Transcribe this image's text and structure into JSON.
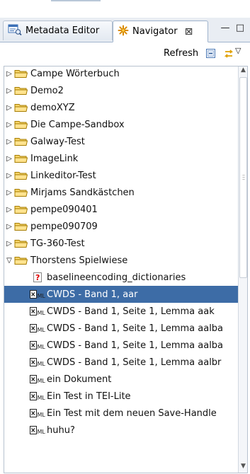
{
  "tabs": [
    {
      "label": "Metadata Editor",
      "icon": "metadata-editor-icon"
    },
    {
      "label": "Navigator",
      "icon": "navigator-icon",
      "close": "⊠"
    }
  ],
  "view_controls": {
    "minimize": "—",
    "maximize": "□"
  },
  "toolbar": {
    "refresh_label": "Refresh",
    "menu_glyph": "▽"
  },
  "tree": {
    "folders": [
      {
        "label": "Campe Wörterbuch",
        "expanded": false
      },
      {
        "label": "Demo2",
        "expanded": false
      },
      {
        "label": "demoXYZ",
        "expanded": false
      },
      {
        "label": "Die Campe-Sandbox",
        "expanded": false
      },
      {
        "label": "Galway-Test",
        "expanded": false
      },
      {
        "label": "ImageLink",
        "expanded": false
      },
      {
        "label": "Linkeditor-Test",
        "expanded": false
      },
      {
        "label": "Mirjams Sandkästchen",
        "expanded": false
      },
      {
        "label": "pempe090401",
        "expanded": false
      },
      {
        "label": "pempe090709",
        "expanded": false
      },
      {
        "label": "TG-360-Test",
        "expanded": false
      },
      {
        "label": "Thorstens Spielwiese",
        "expanded": true
      }
    ],
    "children": [
      {
        "label": "baselineencoding_dictionaries",
        "icon": "unknown-file-icon"
      },
      {
        "label": "CWDS - Band 1, aar",
        "icon": "xml-file-icon",
        "selected": true
      },
      {
        "label": "CWDS - Band 1, Seite 1, Lemma aak",
        "icon": "xml-file-icon"
      },
      {
        "label": "CWDS - Band 1, Seite 1, Lemma aalba",
        "icon": "xml-file-icon"
      },
      {
        "label": "CWDS - Band 1, Seite 1, Lemma aalba",
        "icon": "xml-file-icon"
      },
      {
        "label": "CWDS - Band 1, Seite 1, Lemma aalbr",
        "icon": "xml-file-icon"
      },
      {
        "label": "ein Dokument",
        "icon": "xml-file-icon"
      },
      {
        "label": "Ein Test in TEI-Lite",
        "icon": "xml-file-icon"
      },
      {
        "label": "Ein Test mit dem neuen Save-Handle",
        "icon": "xml-file-icon"
      },
      {
        "label": "huhu?",
        "icon": "xml-file-icon"
      }
    ]
  },
  "colors": {
    "selection": "#3d6ca6",
    "folder": "#f2c94c",
    "accent": "#9fb3cc"
  }
}
